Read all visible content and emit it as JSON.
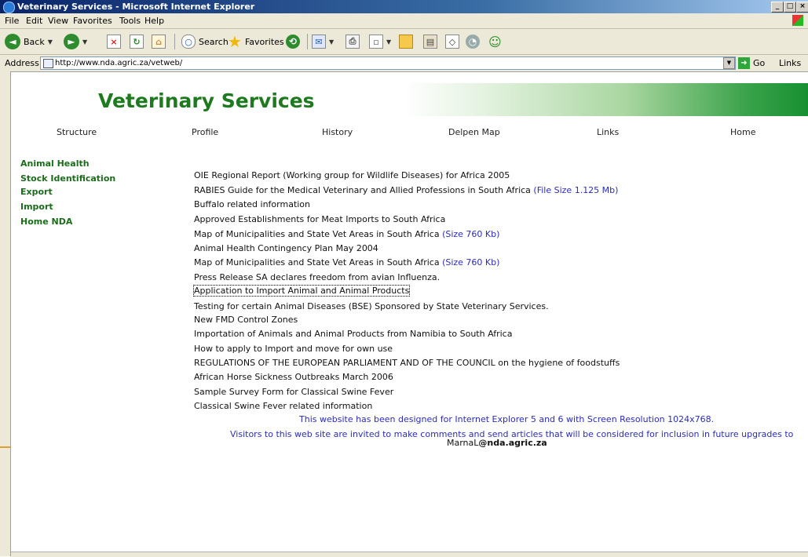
{
  "window": {
    "title": "Veterinary Services - Microsoft Internet Explorer"
  },
  "menu": [
    "File",
    "Edit",
    "View",
    "Favorites",
    "Tools",
    "Help"
  ],
  "toolbar": {
    "back_label": "Back",
    "search_label": "Search",
    "favorites_label": "Favorites"
  },
  "address": {
    "label": "Address",
    "url": "http://www.nda.agric.za/vetweb/",
    "go_label": "Go",
    "links_label": "Links"
  },
  "site": {
    "title": "Veterinary Services",
    "nav": [
      "Structure",
      "Profile",
      "History",
      "Delpen Map",
      "Links",
      "Home"
    ],
    "sidebar": [
      "Animal Health",
      "Stock Identification",
      "Export",
      "Import",
      "Home NDA"
    ],
    "items": [
      {
        "text": "OIE Regional Report (Working group for Wildlife Diseases) for Africa 2005",
        "extra": ""
      },
      {
        "text": "RABIES Guide for the Medical Veterinary and Allied Professions in South Africa",
        "extra": "(File Size 1.125 Mb)"
      },
      {
        "text": "Buffalo related information",
        "extra": ""
      },
      {
        "text": "Approved Establishments for Meat Imports to South Africa",
        "extra": ""
      },
      {
        "text": "Map of Municipalities and State Vet Areas in South Africa",
        "extra": "(Size 760 Kb)"
      },
      {
        "text": "Animal Health Contingency Plan May 2004",
        "extra": ""
      },
      {
        "text": "Map of Municipalities and State Vet Areas in South Africa",
        "extra": "(Size 760 Kb)"
      },
      {
        "text": "Press Release SA declares freedom from avian Influenza.",
        "extra": ""
      },
      {
        "text": "Application to Import Animal and Animal Products",
        "extra": ""
      },
      {
        "text": "Testing for certain Animal Diseases (BSE) Sponsored by State Veterinary Services.",
        "extra": ""
      },
      {
        "text": "New FMD Control Zones",
        "extra": ""
      },
      {
        "text": "Importation of Animals and Animal Products from  Namibia to South Africa",
        "extra": ""
      },
      {
        "text": "How to apply to Import and move for own use",
        "extra": ""
      },
      {
        "text": "REGULATIONS OF THE EUROPEAN PARLIAMENT AND OF THE COUNCIL on the hygiene of foodstuffs",
        "extra": ""
      },
      {
        "text": "African Horse Sickness Outbreaks March 2006",
        "extra": ""
      },
      {
        "text": "Sample Survey Form for Classical Swine Fever",
        "extra": ""
      },
      {
        "text": "Classical Swine Fever related information",
        "extra": ""
      }
    ],
    "note_browser": "This website has been designed for Internet Explorer 5 and 6 with Screen Resolution 1024x768.",
    "note_visitors": "Visitors to this web site are invited to make comments and send articles that will be considered for inclusion in future upgrades to",
    "contact_name": "MarnaL",
    "contact_domain": "@nda.agric.za"
  }
}
